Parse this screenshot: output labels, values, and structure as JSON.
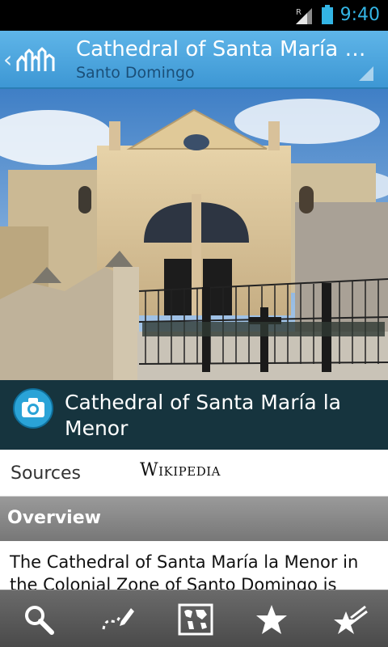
{
  "status_bar": {
    "time": "9:40",
    "network_indicator": "R",
    "accent_color": "#33b5e5"
  },
  "action_bar": {
    "title": "Cathedral of Santa María la…",
    "subtitle": "Santo Domingo",
    "background": "#4aa6dd"
  },
  "photo": {
    "icon": "cathedral-photo"
  },
  "place": {
    "title": "Cathedral of Santa María la Menor"
  },
  "sources": {
    "label": "Sources",
    "link": "Wikipedia"
  },
  "overview": {
    "header": "Overview",
    "text": "The Cathedral of Santa María la Menor in the Colonial Zone of Santo Domingo is"
  },
  "bottom_bar": {
    "items": [
      {
        "icon": "search-icon"
      },
      {
        "icon": "edit-path-icon"
      },
      {
        "icon": "world-map-icon"
      },
      {
        "icon": "star-icon"
      },
      {
        "icon": "starred-list-icon"
      }
    ]
  }
}
